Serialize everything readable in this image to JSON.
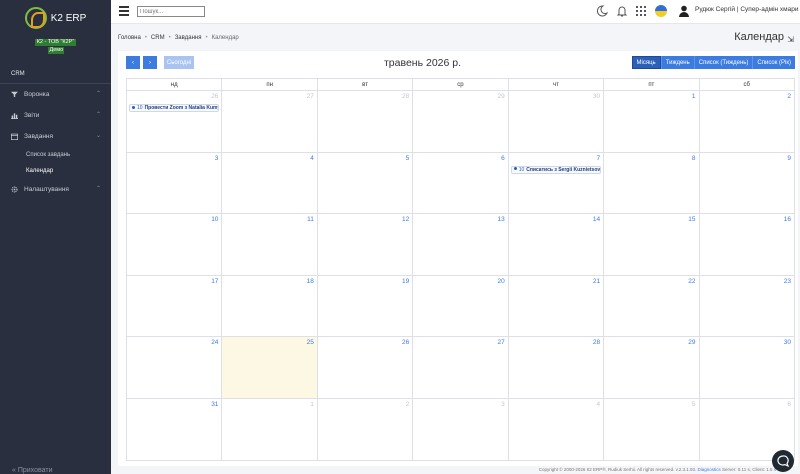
{
  "app": {
    "name": "K2 ERP",
    "company": "К2 - ТОВ \"К2Р\"",
    "mode": "Демо"
  },
  "sidebar": {
    "section": "CRM",
    "items": [
      {
        "label": "Воронка",
        "icon": "funnel-icon"
      },
      {
        "label": "Звіти",
        "icon": "bar-chart-icon"
      },
      {
        "label": "Завдання",
        "icon": "calendar-icon"
      },
      {
        "label": "Налаштування",
        "icon": "gear-icon"
      }
    ],
    "subitems": [
      {
        "label": "Список завдань"
      },
      {
        "label": "Календар"
      }
    ],
    "collapse_label": "Приховати"
  },
  "header": {
    "search_placeholder": "Пошук...",
    "user_name": "Рудюк Сергій | Супер-адмін хмари"
  },
  "breadcrumb": {
    "items": [
      "Головна",
      "CRM",
      "Завдання"
    ],
    "current": "Календар"
  },
  "page": {
    "title": "Календар"
  },
  "calendar": {
    "title": "травень 2026 р.",
    "today_label": "Сьогодні",
    "prev_label": "‹",
    "next_label": "›",
    "views": [
      "Місяць",
      "Тиждень",
      "Список (Тиждень)",
      "Список (Рік)"
    ],
    "active_view": "Місяць",
    "days_of_week": [
      "нд",
      "пн",
      "вт",
      "ср",
      "чт",
      "пт",
      "сб"
    ],
    "weeks": [
      [
        {
          "d": "26",
          "other": true
        },
        {
          "d": "27",
          "other": true
        },
        {
          "d": "28",
          "other": true
        },
        {
          "d": "29",
          "other": true
        },
        {
          "d": "30",
          "other": true
        },
        {
          "d": "1"
        },
        {
          "d": "2"
        }
      ],
      [
        {
          "d": "3"
        },
        {
          "d": "4"
        },
        {
          "d": "5"
        },
        {
          "d": "6"
        },
        {
          "d": "7"
        },
        {
          "d": "8"
        },
        {
          "d": "9"
        }
      ],
      [
        {
          "d": "10"
        },
        {
          "d": "11"
        },
        {
          "d": "12"
        },
        {
          "d": "13"
        },
        {
          "d": "14"
        },
        {
          "d": "15"
        },
        {
          "d": "16"
        }
      ],
      [
        {
          "d": "17"
        },
        {
          "d": "18"
        },
        {
          "d": "19"
        },
        {
          "d": "20"
        },
        {
          "d": "21"
        },
        {
          "d": "22"
        },
        {
          "d": "23"
        }
      ],
      [
        {
          "d": "24"
        },
        {
          "d": "25",
          "today": true
        },
        {
          "d": "26"
        },
        {
          "d": "27"
        },
        {
          "d": "28"
        },
        {
          "d": "29"
        },
        {
          "d": "30"
        }
      ],
      [
        {
          "d": "31"
        },
        {
          "d": "1",
          "other": true
        },
        {
          "d": "2",
          "other": true
        },
        {
          "d": "3",
          "other": true
        },
        {
          "d": "4",
          "other": true
        },
        {
          "d": "5",
          "other": true
        },
        {
          "d": "6",
          "other": true
        }
      ]
    ],
    "events": [
      {
        "week": 0,
        "day": 0,
        "time": "10",
        "title": "Провести Zoom з Natalia Kumych"
      },
      {
        "week": 1,
        "day": 4,
        "time": "10",
        "title": "Списатись з Sergii Kuznietsov"
      }
    ]
  },
  "footer": {
    "text": "Copyright © 2000-2026 К2 ERP®, Rudiuk Serhii. All rights reserved. v.2.3.1.93.",
    "link": "Diagnostics",
    "server": "Server: 0.11 s, Client: 1.5 s"
  },
  "colors": {
    "accent": "#3c7be0",
    "sidebar": "#2a2f3f",
    "today": "#fcf8e3"
  }
}
